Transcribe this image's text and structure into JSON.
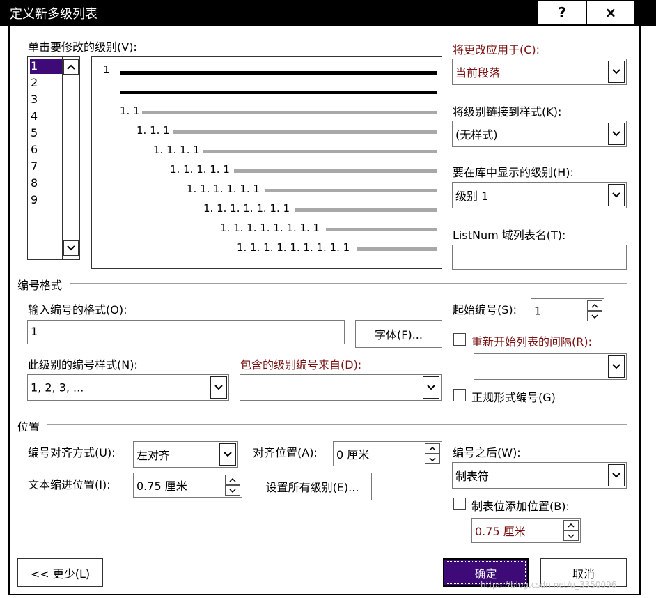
{
  "window": {
    "title": "定义新多级列表",
    "help_label": "?",
    "close_label": "×"
  },
  "levels": {
    "label": "单击要修改的级别(V):",
    "items": [
      "1",
      "2",
      "3",
      "4",
      "5",
      "6",
      "7",
      "8",
      "9"
    ],
    "selected": "1"
  },
  "preview": {
    "lines": [
      "1",
      "1. 1",
      "1. 1. 1",
      "1. 1. 1. 1",
      "1. 1. 1. 1. 1",
      "1. 1. 1. 1. 1. 1",
      "1. 1. 1. 1. 1. 1. 1",
      "1. 1. 1. 1. 1. 1. 1. 1",
      "1. 1. 1. 1. 1. 1. 1. 1. 1"
    ]
  },
  "apply_to": {
    "label": "将更改应用于(C):",
    "value": "当前段落"
  },
  "link_style": {
    "label": "将级别链接到样式(K):",
    "value": "(无样式)"
  },
  "gallery_level": {
    "label": "要在库中显示的级别(H):",
    "value": "级别 1"
  },
  "listnum": {
    "label": "ListNum 域列表名(T):",
    "value": ""
  },
  "number_format": {
    "group_label": "编号格式",
    "format_label": "输入编号的格式(O):",
    "format_value": "1",
    "font_button": "字体(F)...",
    "style_label": "此级别的编号样式(N):",
    "style_value": "1, 2, 3, ...",
    "include_label": "包含的级别编号来自(D):",
    "include_value": ""
  },
  "start_at": {
    "label": "起始编号(S):",
    "value": "1"
  },
  "restart": {
    "label": "重新开始列表的间隔(R):",
    "value": ""
  },
  "legal": {
    "label": "正规形式编号(G)"
  },
  "position": {
    "group_label": "位置",
    "alignment_label": "编号对齐方式(U):",
    "alignment_value": "左对齐",
    "aligned_at_label": "对齐位置(A):",
    "aligned_at_value": "0 厘米",
    "indent_label": "文本缩进位置(I):",
    "indent_value": "0.75 厘米",
    "set_all_button": "设置所有级别(E)...",
    "follow_label": "编号之后(W):",
    "follow_value": "制表符",
    "tab_stop_label": "制表位添加位置(B):",
    "tab_stop_value": "0.75 厘米"
  },
  "footer": {
    "less_button": "<< 更少(L)",
    "ok_button": "确定",
    "cancel_button": "取消",
    "watermark": "https://blog.csdn.net/u_3350096"
  },
  "colors": {
    "accent": "#3d0a78",
    "label_red": "#7a1010",
    "preview_bar_dark": "#000000",
    "preview_bar_gray": "#a8a8a8"
  }
}
